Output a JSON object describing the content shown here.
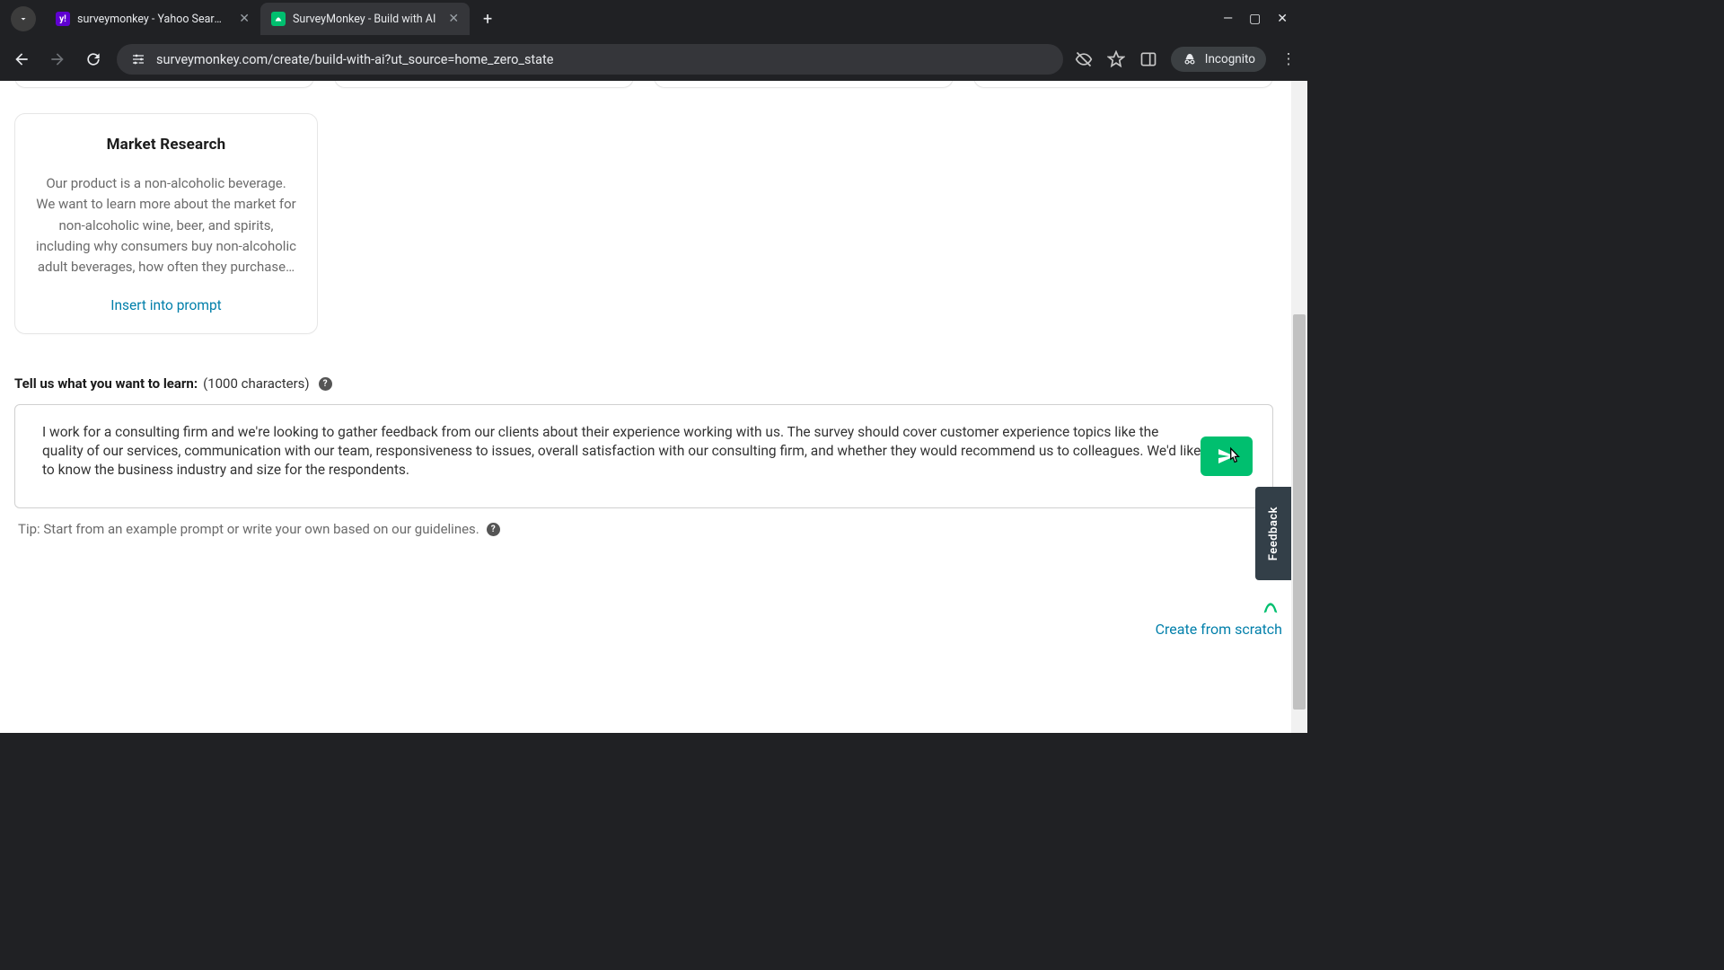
{
  "browser": {
    "tabs": [
      {
        "title": "surveymonkey - Yahoo Search R",
        "favicon": "y!"
      },
      {
        "title": "SurveyMonkey - Build with AI",
        "favicon": "sm"
      }
    ],
    "url": "surveymonkey.com/create/build-with-ai?ut_source=home_zero_state",
    "incognito_label": "Incognito"
  },
  "example_card": {
    "title": "Market Research",
    "body": "Our product is a non-alcoholic beverage. We want to learn more about the market for non-alcoholic wine, beer, and spirits, including why consumers buy non-alcoholic adult beverages, how often they purchase…",
    "insert_label": "Insert into prompt"
  },
  "prompt": {
    "label_bold": "Tell us what you want to learn:",
    "label_chars": "(1000 characters)",
    "value": "I work for a consulting firm and we're looking to gather feedback from our clients about their experience working with us. The survey should cover customer experience topics like the quality of our services, communication with our team, responsiveness to issues, overall satisfaction with our consulting firm, and whether they would recommend us to colleagues. We'd like to know the business industry and size for the respondents.",
    "tip": "Tip: Start from an example prompt or write your own based on our guidelines."
  },
  "links": {
    "create_from_scratch": "Create from scratch"
  },
  "feedback": {
    "label": "Feedback"
  }
}
